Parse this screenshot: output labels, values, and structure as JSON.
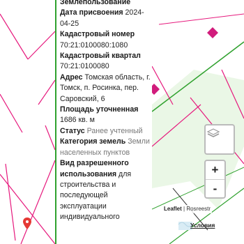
{
  "panel": {
    "land_use_tail": "Землепользование",
    "assign_date_label": "Дата присвоения",
    "assign_date_value": "2024-04-25",
    "cad_number_label": "Кадастровый номер",
    "cad_number_value": "70:21:0100080:1080",
    "cad_quarter_label": "Кадастровый квартал",
    "cad_quarter_value": "70:21:0100080",
    "address_label": "Адрес",
    "address_value": "Томская область, г. Томск, п. Росинка, пер. Саровский, 6",
    "area_label": "Площадь уточненная",
    "area_value": "1686 кв. м",
    "status_label": "Статус",
    "status_value": "Ранее учтенный",
    "category_label": "Категория земель",
    "category_value": "Земли населенных пунктов",
    "permitted_use_label": "Вид разрешенного использования",
    "permitted_use_value": "для строительства и последующей эксплуатации индивидуального"
  },
  "map": {
    "zoom_in": "+",
    "zoom_out": "-",
    "attribution_leaflet": "Leaflet",
    "attribution_sep": " | ",
    "attribution_source": "Rosreestr",
    "terms_link": "Условия",
    "layers_icon": "layers-stack-icon",
    "boundary_color": "#2fa12e",
    "parcel_line_color": "#e6197d",
    "marker_color": "#d11c7c",
    "pin_color": "#e53935"
  }
}
